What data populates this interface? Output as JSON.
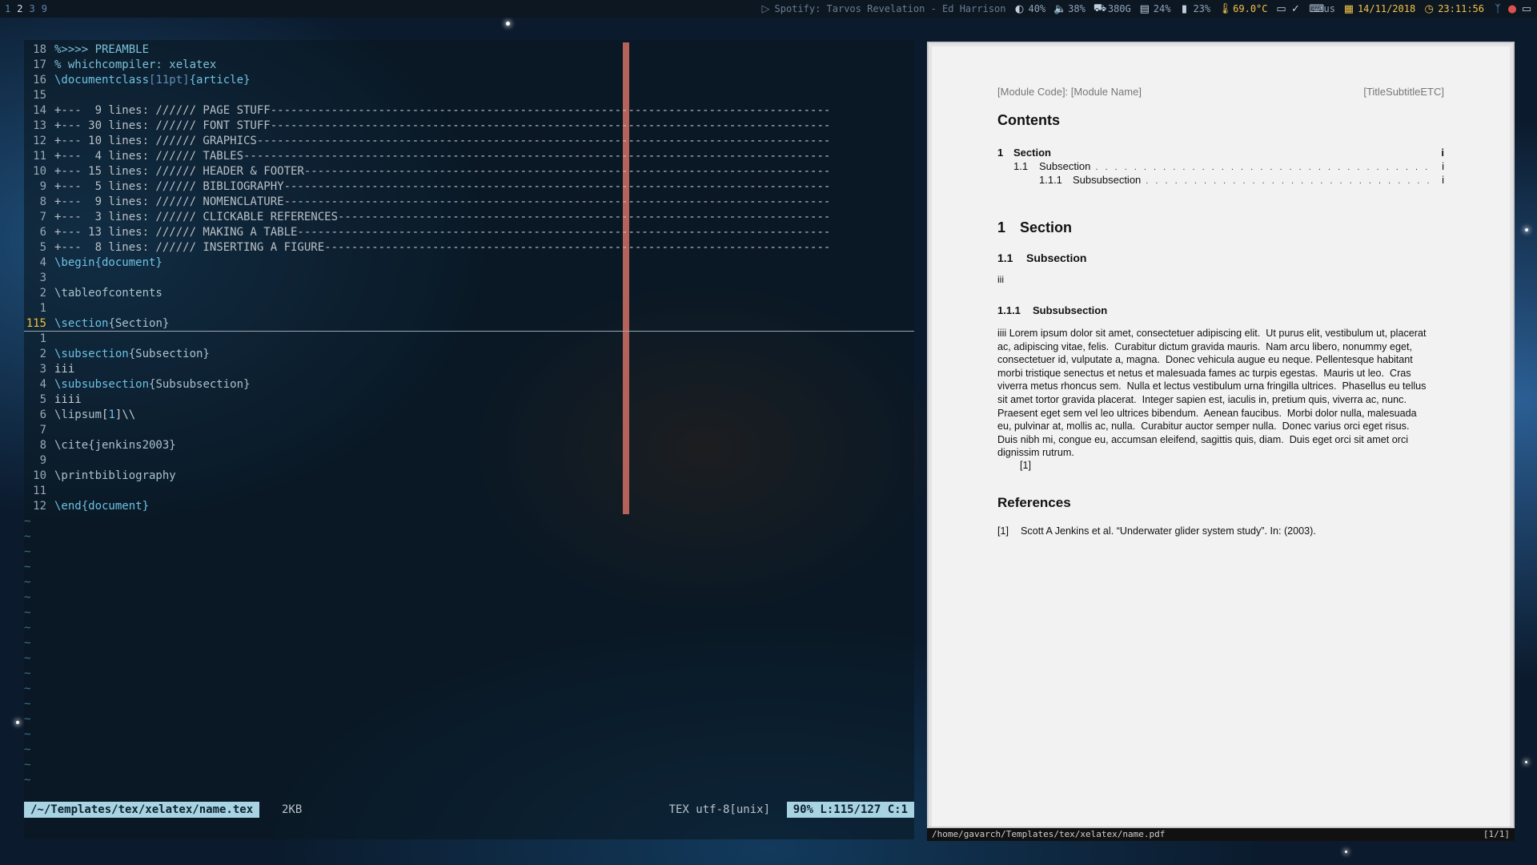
{
  "topbar": {
    "workspaces": [
      "1",
      "2",
      "3",
      "9"
    ],
    "active_workspace": "2",
    "spotify": "Spotify: Tarvos Revelation - Ed Harrison",
    "brightness": "40%",
    "volume": "38%",
    "disk": "380G",
    "memory": "24%",
    "cpu": "23%",
    "temperature": "69.0°C",
    "keyboard_layout": "us",
    "date": "14/11/2018",
    "time": "23:11:56"
  },
  "editor": {
    "lines": [
      {
        "num": "18",
        "parts": [
          {
            "t": "%>>>> PREAMBLE",
            "c": "cm"
          }
        ]
      },
      {
        "num": "17",
        "parts": [
          {
            "t": "% whichcompiler: xelatex",
            "c": "cm"
          }
        ]
      },
      {
        "num": "16",
        "parts": [
          {
            "t": "\\documentclass",
            "c": "kw"
          },
          {
            "t": "[",
            "c": "op"
          },
          {
            "t": "11pt",
            "c": "op"
          },
          {
            "t": "]",
            "c": "op"
          },
          {
            "t": "{article}",
            "c": "kw"
          }
        ]
      },
      {
        "num": "15",
        "parts": []
      },
      {
        "num": "14",
        "parts": [
          {
            "t": "+---  9 lines: ////// PAGE STUFF-----------------------------------------------------------------------------------",
            "c": "fold"
          }
        ]
      },
      {
        "num": "13",
        "parts": [
          {
            "t": "+--- 30 lines: ////// FONT STUFF-----------------------------------------------------------------------------------",
            "c": "fold"
          }
        ]
      },
      {
        "num": "12",
        "parts": [
          {
            "t": "+--- 10 lines: ////// GRAPHICS-------------------------------------------------------------------------------------",
            "c": "fold"
          }
        ]
      },
      {
        "num": "11",
        "parts": [
          {
            "t": "+---  4 lines: ////// TABLES---------------------------------------------------------------------------------------",
            "c": "fold"
          }
        ]
      },
      {
        "num": "10",
        "parts": [
          {
            "t": "+--- 15 lines: ////// HEADER & FOOTER------------------------------------------------------------------------------",
            "c": "fold"
          }
        ]
      },
      {
        "num": "9",
        "parts": [
          {
            "t": "+---  5 lines: ////// BIBLIOGRAPHY---------------------------------------------------------------------------------",
            "c": "fold"
          }
        ]
      },
      {
        "num": "8",
        "parts": [
          {
            "t": "+---  9 lines: ////// NOMENCLATURE---------------------------------------------------------------------------------",
            "c": "fold"
          }
        ]
      },
      {
        "num": "7",
        "parts": [
          {
            "t": "+---  3 lines: ////// CLICKABLE REFERENCES-------------------------------------------------------------------------",
            "c": "fold"
          }
        ]
      },
      {
        "num": "6",
        "parts": [
          {
            "t": "+--- 13 lines: ////// MAKING A TABLE-------------------------------------------------------------------------------",
            "c": "fold"
          }
        ]
      },
      {
        "num": "5",
        "parts": [
          {
            "t": "+---  8 lines: ////// INSERTING A FIGURE---------------------------------------------------------------------------",
            "c": "fold"
          }
        ]
      },
      {
        "num": "4",
        "parts": [
          {
            "t": "\\begin{document}",
            "c": "kw"
          }
        ]
      },
      {
        "num": "3",
        "parts": []
      },
      {
        "num": "2",
        "parts": [
          {
            "t": "\\tableofcontents",
            "c": "arg"
          }
        ]
      },
      {
        "num": "1",
        "parts": []
      },
      {
        "num": "115",
        "current": true,
        "parts": [
          {
            "t": "\\section",
            "c": "kw"
          },
          {
            "t": "{Section}",
            "c": "arg"
          }
        ]
      },
      {
        "num": "1",
        "parts": []
      },
      {
        "num": "2",
        "parts": [
          {
            "t": "\\subsection",
            "c": "kw"
          },
          {
            "t": "{Subsection}",
            "c": "arg"
          }
        ]
      },
      {
        "num": "3",
        "parts": [
          {
            "t": "iii",
            "c": "plain"
          }
        ]
      },
      {
        "num": "4",
        "parts": [
          {
            "t": "\\subsubsection",
            "c": "kw"
          },
          {
            "t": "{Subsubsection}",
            "c": "arg"
          }
        ]
      },
      {
        "num": "5",
        "parts": [
          {
            "t": "iiii",
            "c": "plain"
          }
        ]
      },
      {
        "num": "6",
        "parts": [
          {
            "t": "\\lipsum",
            "c": "arg"
          },
          {
            "t": "[",
            "c": "plain"
          },
          {
            "t": "1",
            "c": "kw"
          },
          {
            "t": "]\\\\",
            "c": "plain"
          }
        ]
      },
      {
        "num": "7",
        "parts": []
      },
      {
        "num": "8",
        "parts": [
          {
            "t": "\\cite{jenkins2003}",
            "c": "arg"
          }
        ]
      },
      {
        "num": "9",
        "parts": []
      },
      {
        "num": "10",
        "parts": [
          {
            "t": "\\printbibliography",
            "c": "arg"
          }
        ]
      },
      {
        "num": "11",
        "parts": []
      },
      {
        "num": "12",
        "parts": [
          {
            "t": "\\end{document}",
            "c": "kw"
          }
        ]
      }
    ],
    "empty_marker": "~",
    "empty_lines": 18,
    "status": {
      "file": "/~/Templates/tex/xelatex/name.tex",
      "size": "2KB",
      "filetype": "TEX utf-8[unix]",
      "position": "90% L:115/127 C:1"
    }
  },
  "pdf": {
    "header_left": "[Module Code]: [Module Name]",
    "header_right": "[TitleSubtitleETC]",
    "contents_heading": "Contents",
    "toc": [
      {
        "num": "1",
        "title": "Section",
        "page": "i",
        "level": 1
      },
      {
        "num": "1.1",
        "title": "Subsection",
        "page": "i",
        "level": 2
      },
      {
        "num": "1.1.1",
        "title": "Subsubsection",
        "page": "i",
        "level": 3
      }
    ],
    "section_num": "1",
    "section_title": "Section",
    "subsection_num": "1.1",
    "subsection_title": "Subsection",
    "subsection_body": "iii",
    "subsubsection_num": "1.1.1",
    "subsubsection_title": "Subsubsection",
    "body_lines": [
      "iiii Lorem ipsum dolor sit amet, consectetuer adipiscing elit.  Ut purus elit, vestibulum ut, placerat",
      "ac, adipiscing vitae, felis.  Curabitur dictum gravida mauris.  Nam arcu libero, nonummy eget,",
      "consectetuer id, vulputate a, magna.  Donec vehicula augue eu neque. Pellentesque habitant",
      "morbi tristique senectus et netus et malesuada fames ac turpis egestas.  Mauris ut leo.  Cras",
      "viverra metus rhoncus sem.  Nulla et lectus vestibulum urna fringilla ultrices.  Phasellus eu tellus",
      "sit amet tortor gravida placerat.  Integer sapien est, iaculis in, pretium quis, viverra ac, nunc.",
      "Praesent eget sem vel leo ultrices bibendum.  Aenean faucibus.  Morbi dolor nulla, malesuada",
      "eu, pulvinar at, mollis ac, nulla.  Curabitur auctor semper nulla.  Donec varius orci eget risus.",
      "Duis nibh mi, congue eu, accumsan eleifend, sagittis quis, diam.  Duis eget orci sit amet orci",
      "dignissim rutrum."
    ],
    "citation": "[1]",
    "references_heading": "References",
    "ref_label": "[1]",
    "ref_text": "Scott A Jenkins et al. “Underwater glider system study”. In: (2003).",
    "status_path": "/home/gavarch/Templates/tex/xelatex/name.pdf",
    "status_page": "[1/1]"
  }
}
